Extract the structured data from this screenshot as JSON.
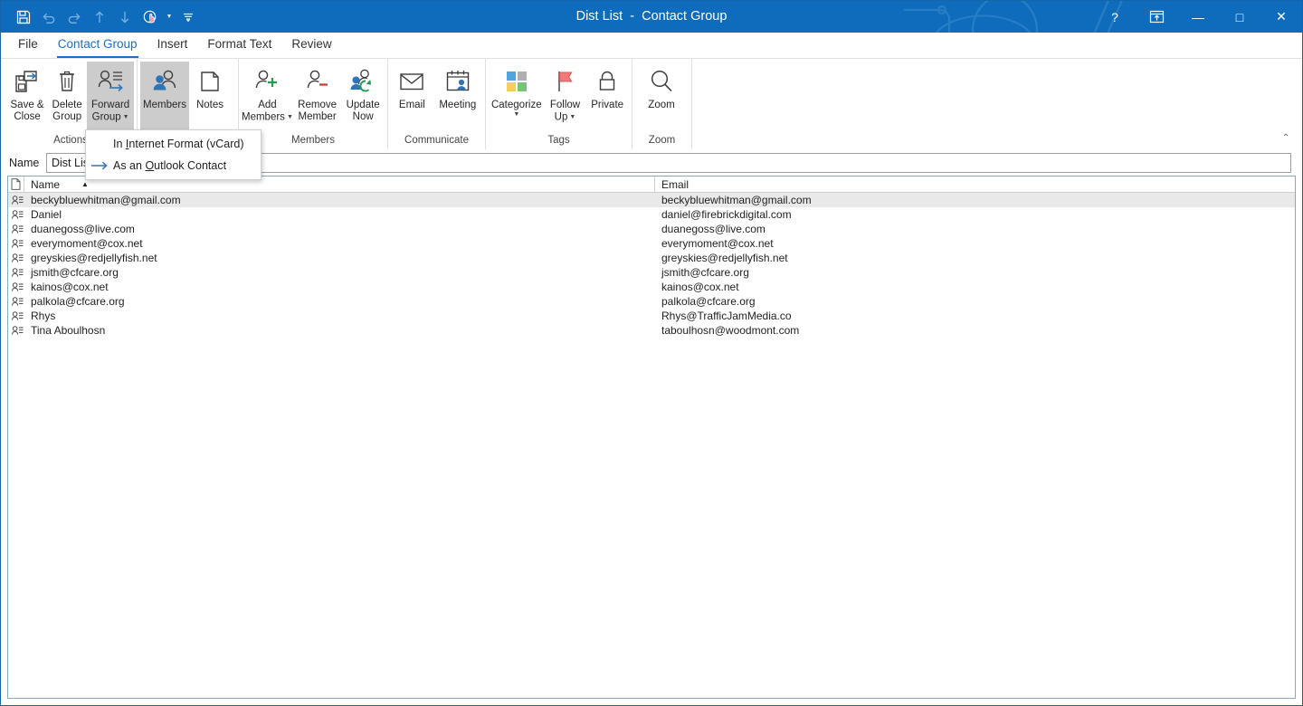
{
  "window": {
    "title": "Dist List  -  Contact Group",
    "accent_color": "#0f6cbd"
  },
  "quick_access": {
    "items": [
      {
        "name": "save-icon",
        "label": "Save",
        "enabled": true
      },
      {
        "name": "undo-icon",
        "label": "Undo",
        "enabled": false
      },
      {
        "name": "redo-icon",
        "label": "Redo",
        "enabled": false
      },
      {
        "name": "previous-item-icon",
        "label": "Previous Item",
        "enabled": false
      },
      {
        "name": "next-item-icon",
        "label": "Next Item",
        "enabled": false
      },
      {
        "name": "touch-mouse-mode-icon",
        "label": "Touch/Mouse Mode",
        "enabled": true
      },
      {
        "name": "customize-quick-access-toolbar-icon",
        "label": "Customize Quick Access Toolbar",
        "enabled": true
      }
    ]
  },
  "window_controls": {
    "help": "?",
    "ribbon_display_options": "Ribbon Display Options",
    "minimize": "—",
    "maximize": "□",
    "close": "✕"
  },
  "tabs": [
    {
      "label": "File",
      "active": false
    },
    {
      "label": "Contact Group",
      "active": true
    },
    {
      "label": "Insert",
      "active": false
    },
    {
      "label": "Format Text",
      "active": false
    },
    {
      "label": "Review",
      "active": false
    }
  ],
  "ribbon": {
    "collapse_label": "⌃",
    "groups": [
      {
        "label": "Actions",
        "buttons": [
          {
            "label_line1": "Save &",
            "label_line2": "Close",
            "icon": "save-and-close-icon",
            "has_caret": false,
            "active": false
          },
          {
            "label_line1": "Delete",
            "label_line2": "Group",
            "icon": "delete-group-icon",
            "has_caret": false,
            "active": false
          },
          {
            "label_line1": "Forward",
            "label_line2": "Group",
            "icon": "forward-group-icon",
            "has_caret": true,
            "active": true
          }
        ]
      },
      {
        "label": "",
        "buttons": [
          {
            "label_line1": "Members",
            "label_line2": "",
            "icon": "members-icon",
            "has_caret": false,
            "active": true
          },
          {
            "label_line1": "Notes",
            "label_line2": "",
            "icon": "notes-icon",
            "has_caret": false,
            "active": false
          }
        ]
      },
      {
        "label": "Members",
        "buttons": [
          {
            "label_line1": "Add",
            "label_line2": "Members",
            "icon": "add-members-icon",
            "has_caret": true,
            "active": false
          },
          {
            "label_line1": "Remove",
            "label_line2": "Member",
            "icon": "remove-member-icon",
            "has_caret": false,
            "active": false
          },
          {
            "label_line1": "Update",
            "label_line2": "Now",
            "icon": "update-now-icon",
            "has_caret": false,
            "active": false
          }
        ]
      },
      {
        "label": "Communicate",
        "buttons": [
          {
            "label_line1": "Email",
            "label_line2": "",
            "icon": "email-icon",
            "has_caret": false,
            "active": false
          },
          {
            "label_line1": "Meeting",
            "label_line2": "",
            "icon": "meeting-icon",
            "has_caret": false,
            "active": false
          }
        ]
      },
      {
        "label": "Tags",
        "buttons": [
          {
            "label_line1": "Categorize",
            "label_line2": "",
            "icon": "categorize-icon",
            "has_caret": true,
            "active": false
          },
          {
            "label_line1": "Follow",
            "label_line2": "Up",
            "icon": "follow-up-icon",
            "has_caret": true,
            "active": false
          },
          {
            "label_line1": "Private",
            "label_line2": "",
            "icon": "private-icon",
            "has_caret": false,
            "active": false
          }
        ]
      },
      {
        "label": "Zoom",
        "buttons": [
          {
            "label_line1": "Zoom",
            "label_line2": "",
            "icon": "zoom-icon",
            "has_caret": false,
            "active": false
          }
        ]
      }
    ]
  },
  "forward_group_menu": {
    "items": [
      {
        "label_pre": "In ",
        "accel": "I",
        "label_post": "nternet Format (vCard)",
        "icon": ""
      },
      {
        "label_pre": "As an ",
        "accel": "O",
        "label_post": "utlook Contact",
        "icon": "forward-arrow-icon"
      }
    ]
  },
  "name_field": {
    "label": "Name",
    "value": "Dist List",
    "placeholder": ""
  },
  "grid": {
    "columns": [
      {
        "key": "icon",
        "label": ""
      },
      {
        "key": "name",
        "label": "Name",
        "sort": "asc",
        "sort_glyph": "▲"
      },
      {
        "key": "email",
        "label": "Email",
        "sort": ""
      }
    ],
    "rows": [
      {
        "name": "beckybluewhitman@gmail.com",
        "email": "beckybluewhitman@gmail.com",
        "selected": true
      },
      {
        "name": "Daniel",
        "email": "daniel@firebrickdigital.com",
        "selected": false
      },
      {
        "name": "duanegoss@live.com",
        "email": "duanegoss@live.com",
        "selected": false
      },
      {
        "name": "everymoment@cox.net",
        "email": "everymoment@cox.net",
        "selected": false
      },
      {
        "name": "greyskies@redjellyfish.net",
        "email": "greyskies@redjellyfish.net",
        "selected": false
      },
      {
        "name": "jsmith@cfcare.org",
        "email": "jsmith@cfcare.org",
        "selected": false
      },
      {
        "name": "kainos@cox.net",
        "email": "kainos@cox.net",
        "selected": false
      },
      {
        "name": "palkola@cfcare.org",
        "email": "palkola@cfcare.org",
        "selected": false
      },
      {
        "name": "Rhys",
        "email": "Rhys@TrafficJamMedia.co",
        "selected": false
      },
      {
        "name": "Tina Aboulhosn",
        "email": "taboulhosn@woodmont.com",
        "selected": false
      }
    ]
  }
}
